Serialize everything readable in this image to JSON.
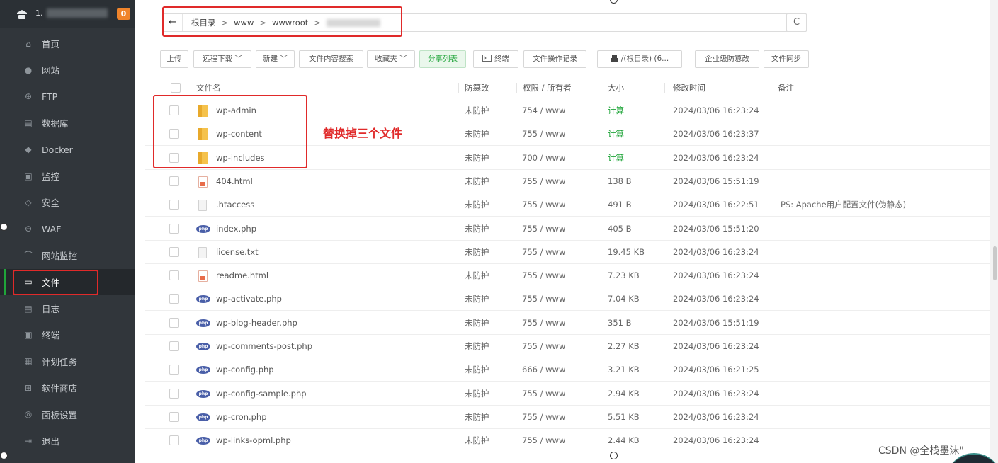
{
  "sidebar": {
    "server_badge": "0",
    "items": [
      {
        "label": "首页",
        "icon": "home-icon"
      },
      {
        "label": "网站",
        "icon": "globe-icon"
      },
      {
        "label": "FTP",
        "icon": "ftp-icon"
      },
      {
        "label": "数据库",
        "icon": "database-icon"
      },
      {
        "label": "Docker",
        "icon": "docker-icon"
      },
      {
        "label": "监控",
        "icon": "monitor-icon"
      },
      {
        "label": "安全",
        "icon": "shield-icon"
      },
      {
        "label": "WAF",
        "icon": "waf-icon"
      },
      {
        "label": "网站监控",
        "icon": "chart-icon"
      },
      {
        "label": "文件",
        "icon": "folder-icon"
      },
      {
        "label": "日志",
        "icon": "log-icon"
      },
      {
        "label": "终端",
        "icon": "terminal-icon"
      },
      {
        "label": "计划任务",
        "icon": "calendar-icon"
      },
      {
        "label": "软件商店",
        "icon": "grid-icon"
      },
      {
        "label": "面板设置",
        "icon": "gear-icon"
      },
      {
        "label": "退出",
        "icon": "logout-icon"
      }
    ],
    "active_item": "文件"
  },
  "pathbar": {
    "back_icon": "←",
    "crumbs": [
      "根目录",
      "www",
      "wwwroot"
    ],
    "refresh_icon": "C"
  },
  "toolbar": {
    "upload": "上传",
    "remote_download": "远程下载",
    "new": "新建",
    "content_search": "文件内容搜索",
    "favorites": "收藏夹",
    "share_list": "分享列表",
    "terminal": "终端",
    "op_log": "文件操作记录",
    "disk": "/(根目录) (6...",
    "anti_tamper": "企业级防篡改",
    "file_sync": "文件同步",
    "chevron": "﹀"
  },
  "table": {
    "headers": {
      "name": "文件名",
      "tamper": "防篡改",
      "perm": "权限 / 所有者",
      "size": "大小",
      "mtime": "修改时间",
      "note": "备注"
    },
    "rows": [
      {
        "name": "wp-admin",
        "type": "folder",
        "tamper": "未防护",
        "perm": "754 / www",
        "size": "计算",
        "calc": true,
        "mtime": "2024/03/06 16:23:24",
        "note": ""
      },
      {
        "name": "wp-content",
        "type": "folder",
        "tamper": "未防护",
        "perm": "755 / www",
        "size": "计算",
        "calc": true,
        "mtime": "2024/03/06 16:23:37",
        "note": ""
      },
      {
        "name": "wp-includes",
        "type": "folder",
        "tamper": "未防护",
        "perm": "700 / www",
        "size": "计算",
        "calc": true,
        "mtime": "2024/03/06 16:23:24",
        "note": ""
      },
      {
        "name": "404.html",
        "type": "html",
        "tamper": "未防护",
        "perm": "755 / www",
        "size": "138 B",
        "calc": false,
        "mtime": "2024/03/06 15:51:19",
        "note": ""
      },
      {
        "name": ".htaccess",
        "type": "txt",
        "tamper": "未防护",
        "perm": "755 / www",
        "size": "491 B",
        "calc": false,
        "mtime": "2024/03/06 16:22:51",
        "note": "PS: Apache用户配置文件(伪静态)"
      },
      {
        "name": "index.php",
        "type": "php",
        "tamper": "未防护",
        "perm": "755 / www",
        "size": "405 B",
        "calc": false,
        "mtime": "2024/03/06 15:51:20",
        "note": ""
      },
      {
        "name": "license.txt",
        "type": "txt",
        "tamper": "未防护",
        "perm": "755 / www",
        "size": "19.45 KB",
        "calc": false,
        "mtime": "2024/03/06 16:23:24",
        "note": ""
      },
      {
        "name": "readme.html",
        "type": "html",
        "tamper": "未防护",
        "perm": "755 / www",
        "size": "7.23 KB",
        "calc": false,
        "mtime": "2024/03/06 16:23:24",
        "note": ""
      },
      {
        "name": "wp-activate.php",
        "type": "php",
        "tamper": "未防护",
        "perm": "755 / www",
        "size": "7.04 KB",
        "calc": false,
        "mtime": "2024/03/06 16:23:24",
        "note": ""
      },
      {
        "name": "wp-blog-header.php",
        "type": "php",
        "tamper": "未防护",
        "perm": "755 / www",
        "size": "351 B",
        "calc": false,
        "mtime": "2024/03/06 15:51:19",
        "note": ""
      },
      {
        "name": "wp-comments-post.php",
        "type": "php",
        "tamper": "未防护",
        "perm": "755 / www",
        "size": "2.27 KB",
        "calc": false,
        "mtime": "2024/03/06 16:23:24",
        "note": ""
      },
      {
        "name": "wp-config.php",
        "type": "php",
        "tamper": "未防护",
        "perm": "666 / www",
        "size": "3.21 KB",
        "calc": false,
        "mtime": "2024/03/06 16:21:25",
        "note": ""
      },
      {
        "name": "wp-config-sample.php",
        "type": "php",
        "tamper": "未防护",
        "perm": "755 / www",
        "size": "2.94 KB",
        "calc": false,
        "mtime": "2024/03/06 16:23:24",
        "note": ""
      },
      {
        "name": "wp-cron.php",
        "type": "php",
        "tamper": "未防护",
        "perm": "755 / www",
        "size": "5.51 KB",
        "calc": false,
        "mtime": "2024/03/06 16:23:24",
        "note": ""
      },
      {
        "name": "wp-links-opml.php",
        "type": "php",
        "tamper": "未防护",
        "perm": "755 / www",
        "size": "2.44 KB",
        "calc": false,
        "mtime": "2024/03/06 16:23:24",
        "note": ""
      }
    ]
  },
  "annotation": "替换掉三个文件",
  "watermark": "CSDN @全栈墨沫\"",
  "colors": {
    "sidebar_bg": "#31363b",
    "accent_green": "#20a53a",
    "annotation_red": "#e02a2a",
    "badge_orange": "#f0842b"
  }
}
